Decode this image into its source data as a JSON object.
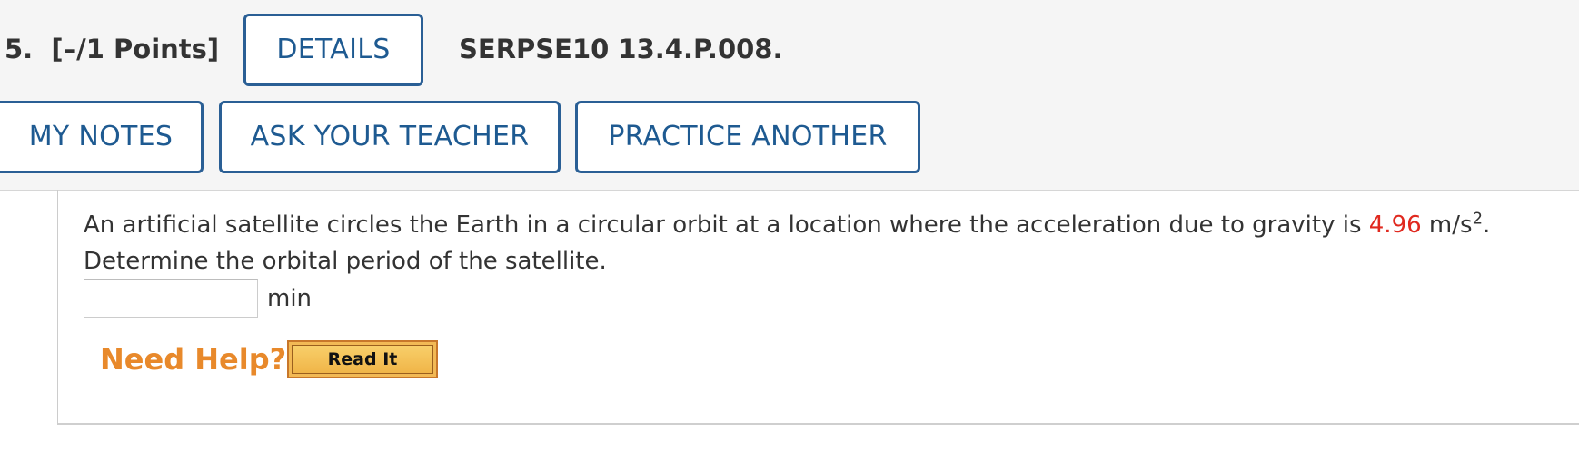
{
  "question": {
    "number": "5.",
    "points": "[–/1 Points]",
    "code": "SERPSE10 13.4.P.008."
  },
  "buttons": {
    "details": "DETAILS",
    "my_notes": "MY NOTES",
    "ask_teacher": "ASK YOUR TEACHER",
    "practice_another": "PRACTICE ANOTHER"
  },
  "problem": {
    "text_before": "An artificial satellite circles the Earth in a circular orbit at a location where the acceleration due to gravity is ",
    "value": "4.96",
    "unit_base": " m/s",
    "unit_exp": "2",
    "text_after": ".",
    "line2": "Determine the orbital period of the satellite."
  },
  "answer": {
    "value": "",
    "unit": "min"
  },
  "help": {
    "label": "Need Help?",
    "read_it": "Read It"
  },
  "colors": {
    "button_text": "#1e5a91",
    "button_border": "#2a5f95",
    "given_value": "#e0291f",
    "need_help": "#e8892b",
    "read_it_bg": "#f2b955"
  }
}
